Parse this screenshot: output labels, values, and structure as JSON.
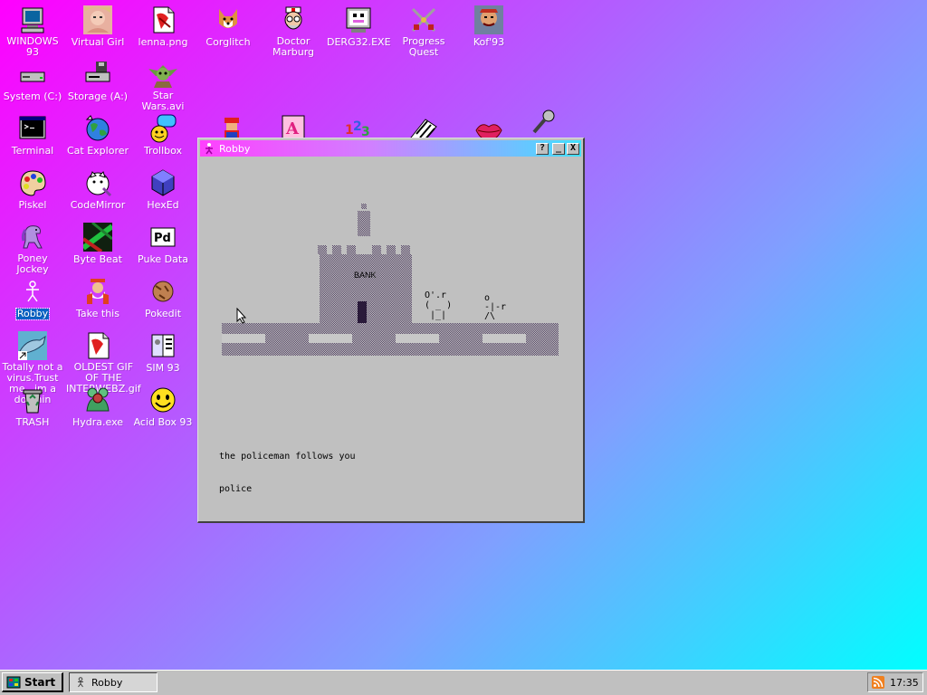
{
  "desktop": {
    "icons": [
      {
        "name": "windows93",
        "label": "WINDOWS 93",
        "icon": "computer-icon"
      },
      {
        "name": "virtual-girl",
        "label": "Virtual Girl",
        "icon": "face-icon"
      },
      {
        "name": "lenna",
        "label": "lenna.png",
        "icon": "image-file-icon"
      },
      {
        "name": "corglitch",
        "label": "Corglitch",
        "icon": "corgi-icon"
      },
      {
        "name": "doctor-marburg",
        "label": "Doctor Marburg",
        "icon": "doctor-icon"
      },
      {
        "name": "derg32",
        "label": "DERG32.EXE",
        "icon": "dragon-monitor-icon"
      },
      {
        "name": "progress-quest",
        "label": "Progress Quest",
        "icon": "crossed-swords-icon"
      },
      {
        "name": "kof93",
        "label": "Kof'93",
        "icon": "fighter-icon"
      },
      {
        "name": "system-c",
        "label": "System (C:)",
        "icon": "drive-icon"
      },
      {
        "name": "storage-a",
        "label": "Storage (A:)",
        "icon": "floppy-drive-icon"
      },
      {
        "name": "star-wars",
        "label": "Star Wars.avi",
        "icon": "yoda-icon"
      },
      {
        "name": "terminal",
        "label": "Terminal",
        "icon": "terminal-icon"
      },
      {
        "name": "cat-explorer",
        "label": "Cat Explorer",
        "icon": "globe-icon"
      },
      {
        "name": "trollbox",
        "label": "Trollbox",
        "icon": "chat-icon"
      },
      {
        "name": "piskel",
        "label": "Piskel",
        "icon": "palette-icon"
      },
      {
        "name": "codemirror",
        "label": "CodeMirror",
        "icon": "cat-code-icon"
      },
      {
        "name": "hexed",
        "label": "HexEd",
        "icon": "cube-icon"
      },
      {
        "name": "poney-jockey",
        "label": "Poney Jockey",
        "icon": "pony-icon"
      },
      {
        "name": "byte-beat",
        "label": "Byte Beat",
        "icon": "waveform-icon"
      },
      {
        "name": "puke-data",
        "label": "Puke Data",
        "icon": "pd-icon"
      },
      {
        "name": "robby",
        "label": "Robby",
        "icon": "stickman-icon"
      },
      {
        "name": "take-this",
        "label": "Take this",
        "icon": "old-man-icon"
      },
      {
        "name": "pokedit",
        "label": "Pokedit",
        "icon": "pokeball-icon"
      },
      {
        "name": "totally-not-a-virus",
        "label": "Totally not a virus.Trust me...im a dolphin",
        "icon": "dolphin-icon"
      },
      {
        "name": "oldest-gif",
        "label": "OLDEST GIF OF THE INTERWEBZ.gif",
        "icon": "gif-file-icon"
      },
      {
        "name": "sim93",
        "label": "SIM 93",
        "icon": "book-icon"
      },
      {
        "name": "trash",
        "label": "TRASH",
        "icon": "recycle-bin-icon"
      },
      {
        "name": "hydra",
        "label": "Hydra.exe",
        "icon": "hydra-icon"
      },
      {
        "name": "acid-box",
        "label": "Acid Box 93",
        "icon": "smiley-icon"
      }
    ]
  },
  "window": {
    "title": "Robby",
    "buttons": {
      "help": "?",
      "minimize": "_",
      "close": "X"
    },
    "scene": {
      "bank_sign": "BANK",
      "cop_text": "O'.r\n( _ )\n |_|",
      "robby_text": "o\n-|-r\n/\\"
    },
    "console_lines": [
      "the policeman follows you",
      "police"
    ]
  },
  "taskbar": {
    "start_label": "Start",
    "task_label": "Robby",
    "clock": "17:35"
  },
  "colors": {
    "gradient_start": "#ff00ff",
    "gradient_end": "#00ffff",
    "window_face": "#c0c0c0",
    "selection": "#0a64c8"
  }
}
